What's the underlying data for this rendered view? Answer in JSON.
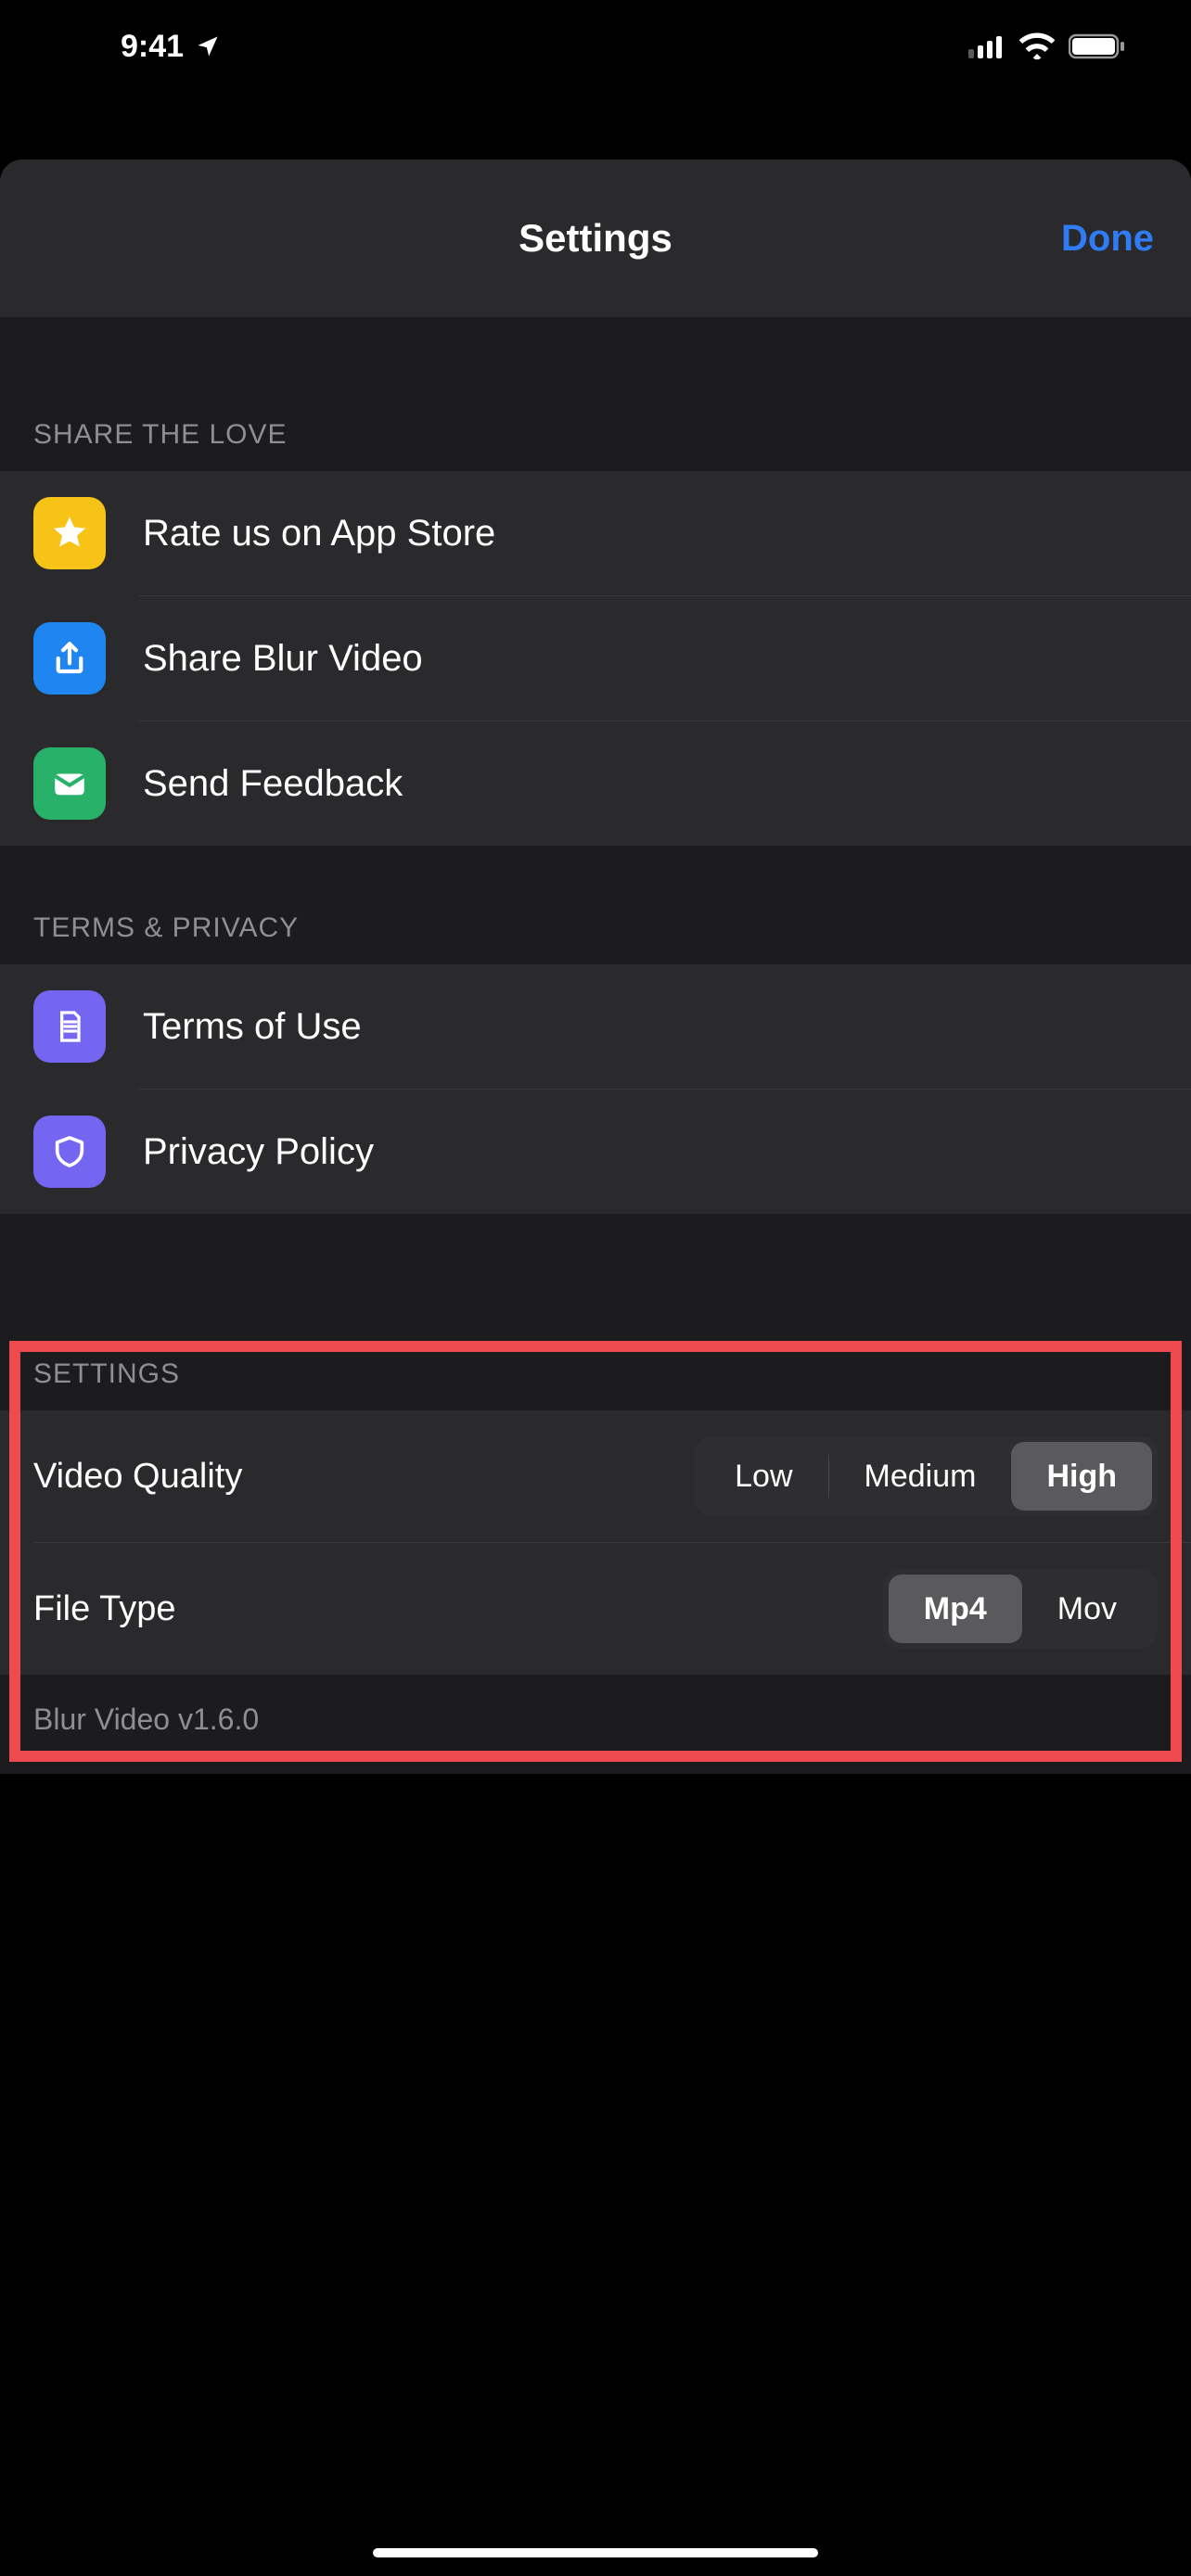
{
  "status": {
    "time": "9:41"
  },
  "nav": {
    "title": "Settings",
    "done": "Done"
  },
  "sections": {
    "share": {
      "header": "SHARE THE LOVE",
      "rate": "Rate us on App Store",
      "share": "Share Blur Video",
      "feedback": "Send Feedback"
    },
    "terms": {
      "header": "TERMS & PRIVACY",
      "tos": "Terms of Use",
      "privacy": "Privacy Policy"
    },
    "settings": {
      "header": "SETTINGS",
      "quality_label": "Video Quality",
      "quality_options": {
        "low": "Low",
        "medium": "Medium",
        "high": "High"
      },
      "quality_selected": "High",
      "filetype_label": "File Type",
      "filetype_options": {
        "mp4": "Mp4",
        "mov": "Mov"
      },
      "filetype_selected": "Mp4"
    }
  },
  "version": "Blur Video v1.6.0"
}
